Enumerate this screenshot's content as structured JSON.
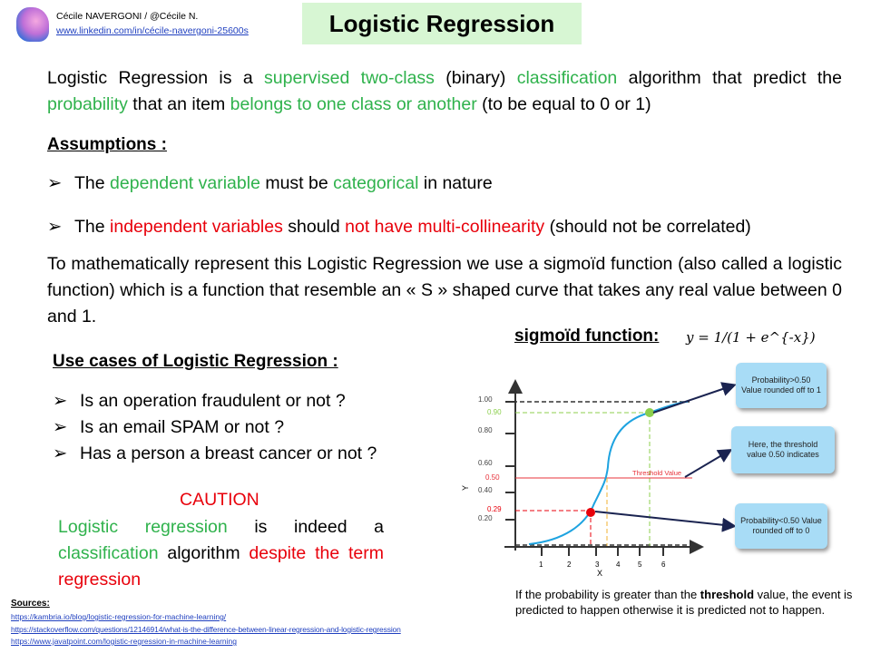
{
  "header": {
    "author": "Cécile NAVERGONI  / @Cécile N.",
    "link": "www.linkedin.com/in/cécile-navergoni-25600s",
    "title": "Logistic Regression"
  },
  "intro": {
    "p1": "Logistic Regression is a ",
    "p2": "supervised two-class",
    "p3": " (binary) ",
    "p4": "classification",
    "p5": " algorithm that predict the ",
    "p6": "probability",
    "p7": " that an item ",
    "p8": "belongs to one class or another",
    "p9": " (to be equal to 0 or 1)"
  },
  "assumptions": {
    "heading": "Assumptions :",
    "a1": {
      "t1": "The ",
      "t2": "dependent variable",
      "t3": " must be ",
      "t4": "categorical",
      "t5": " in nature"
    },
    "a2": {
      "t1": "The ",
      "t2": "independent variables",
      "t3": " should ",
      "t4": "not have multi-collinearity",
      "t5": " (should not be correlated)"
    }
  },
  "math_text": "To mathematically represent this Logistic Regression we use a sigmoïd function (also called a logistic function) which is a function that resemble an « S » shaped curve that takes any real value between 0 and 1.",
  "sigmoid": {
    "label": "sigmoïd function:",
    "formula": "y = 1/(1 + e^{-x})"
  },
  "use_cases": {
    "heading": "Use cases of Logistic Regression :",
    "items": [
      "Is an operation fraudulent or not ?",
      "Is an email SPAM or not ?",
      "Has a person a breast cancer or not ?"
    ]
  },
  "caution": {
    "title": "CAUTION",
    "t1": "Logistic regression",
    "t2": " is indeed a ",
    "t3": "classification",
    "t4": " algorithm ",
    "t5": "despite the term regression"
  },
  "figure": {
    "y_ticks": [
      "1.00",
      "0.80",
      "0.60",
      "0.40",
      "0.20"
    ],
    "y_marks": {
      "high": "0.90",
      "threshold": "0.50",
      "low": "0.29"
    },
    "x_ticks": [
      "1",
      "2",
      "3",
      "4",
      "5",
      "6"
    ],
    "xlabel": "X",
    "ylabel": "Y",
    "threshold_label": "Threshold Value",
    "callouts": [
      "Probability>0.50 Value rounded off to 1",
      "Here, the threshold value 0.50 indicates",
      "Probability<0.50 Value rounded off to 0"
    ],
    "colors": {
      "curve": "#1ea3e0",
      "high": "#8ccf4d",
      "threshold": "#e8333b",
      "low": "#e8000b",
      "callout": "#a8dcf6"
    }
  },
  "note": {
    "t1": "If the probability is greater than the ",
    "t2": "threshold",
    "t3": " value, the event is predicted to happen otherwise it is predicted not to happen."
  },
  "sources": {
    "heading": "Sources:",
    "links": [
      "https://kambria.io/blog/logistic-regression-for-machine-learning/",
      "https://stackoverflow.com/questions/12146914/what-is-the-difference-between-linear-regression-and-logistic-regression",
      "https://www.javatpoint.com/logistic-regression-in-machine-learning"
    ]
  }
}
